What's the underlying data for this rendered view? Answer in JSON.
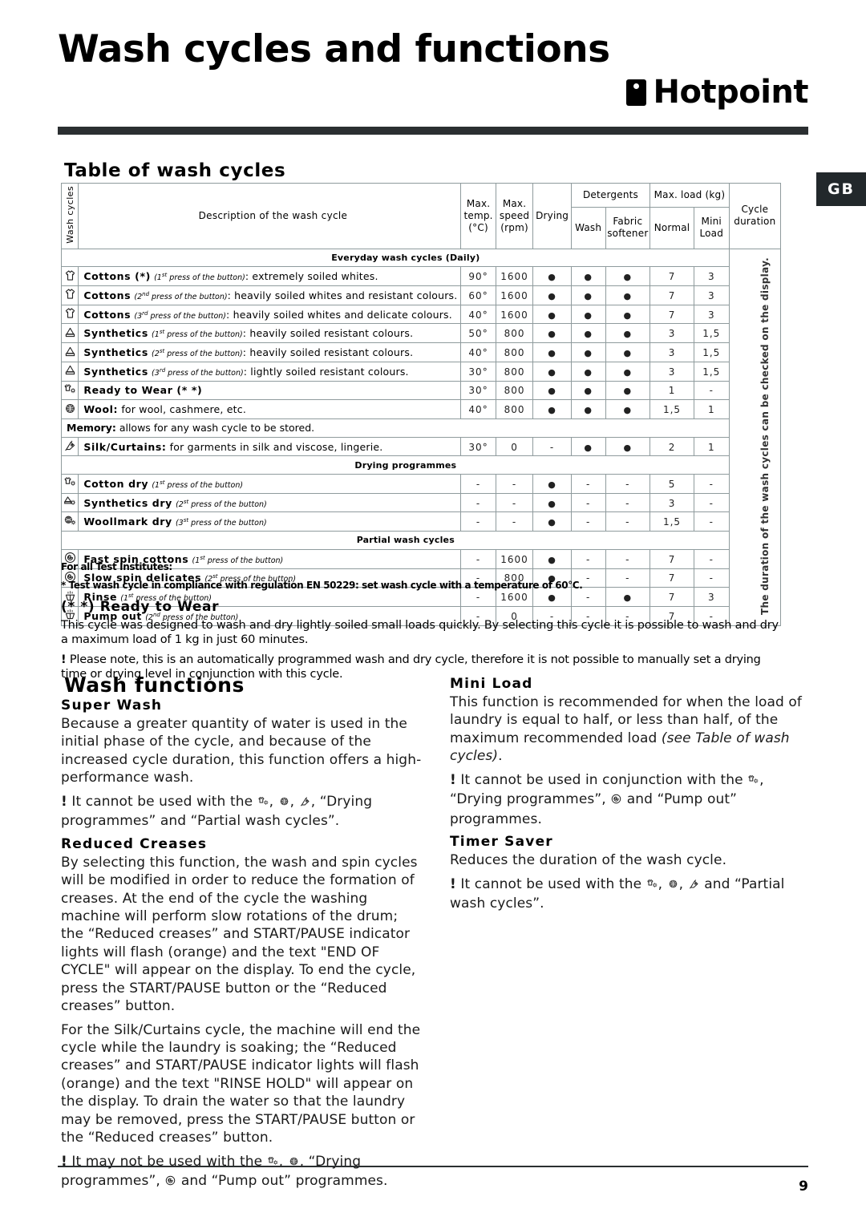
{
  "header": {
    "title": "Wash cycles and functions",
    "brand": "Hotpoint",
    "locale_tab": "GB"
  },
  "table_section": {
    "title": "Table of wash cycles",
    "vertical_label": "Wash cycles",
    "headers": {
      "description": "Description of the wash cycle",
      "max_temp": "Max. temp. (°C)",
      "max_temp_l1": "Max.",
      "max_temp_l2": "temp.",
      "max_temp_l3": "(°C)",
      "max_speed_l1": "Max.",
      "max_speed_l2": "speed",
      "max_speed_l3": "(rpm)",
      "drying": "Drying",
      "detergents": "Detergents",
      "wash": "Wash",
      "fabric_softener_l1": "Fabric",
      "fabric_softener_l2": "softener",
      "max_load": "Max. load (kg)",
      "normal": "Normal",
      "mini_l1": "Mini",
      "mini_l2": "Load",
      "cycle_duration_l1": "Cycle",
      "cycle_duration_l2": "duration"
    },
    "duration_note": "The duration of the wash cycles can be checked on the display.",
    "bands": {
      "everyday": "Everyday wash cycles (Daily)",
      "drying": "Drying programmes",
      "partial": "Partial wash cycles"
    },
    "rows": [
      {
        "icon": "tshirt-icon",
        "name": "Cottons (*)",
        "press": "(1st press of the button)",
        "press_ord": "st",
        "press_num": "1",
        "detail": ": extremely soiled whites.",
        "temp": "90°",
        "speed": "1600",
        "dry": "•",
        "wash": "•",
        "softener": "•",
        "normal": "7",
        "mini": "3"
      },
      {
        "icon": "tshirt-icon",
        "name": "Cottons",
        "press_num": "2",
        "press_ord": "nd",
        "press": "(2nd press of the button)",
        "detail": ": heavily soiled whites and resistant colours.",
        "temp": "60°",
        "speed": "1600",
        "dry": "•",
        "wash": "•",
        "softener": "•",
        "normal": "7",
        "mini": "3"
      },
      {
        "icon": "tshirt-icon",
        "name": "Cottons",
        "press_num": "3",
        "press_ord": "rd",
        "press": "(3rd press of the button)",
        "detail": ": heavily soiled whites and delicate colours.",
        "temp": "40°",
        "speed": "1600",
        "dry": "•",
        "wash": "•",
        "softener": "•",
        "normal": "7",
        "mini": "3"
      },
      {
        "icon": "synthetics-icon",
        "name": "Synthetics",
        "press_num": "1",
        "press_ord": "st",
        "press": "(1st press of the button)",
        "detail": ": heavily soiled resistant colours.",
        "temp": "50°",
        "speed": "800",
        "dry": "•",
        "wash": "•",
        "softener": "•",
        "normal": "3",
        "mini": "1,5"
      },
      {
        "icon": "synthetics-icon",
        "name": "Synthetics",
        "press_num": "2",
        "press_ord": "st",
        "press": "(2st press of the button)",
        "detail": ": heavily soiled resistant colours.",
        "temp": "40°",
        "speed": "800",
        "dry": "•",
        "wash": "•",
        "softener": "•",
        "normal": "3",
        "mini": "1,5"
      },
      {
        "icon": "synthetics-icon",
        "name": "Synthetics",
        "press_num": "3",
        "press_ord": "rd",
        "press": "(3rd press of the button)",
        "detail": ": lightly soiled resistant colours.",
        "temp": "30°",
        "speed": "800",
        "dry": "•",
        "wash": "•",
        "softener": "•",
        "normal": "3",
        "mini": "1,5"
      },
      {
        "icon": "ready-to-wear-icon",
        "name": "Ready to Wear (* *)",
        "press": "",
        "press_num": "",
        "press_ord": "",
        "detail": "",
        "temp": "30°",
        "speed": "800",
        "dry": "•",
        "wash": "•",
        "softener": "•",
        "normal": "1",
        "mini": "-"
      },
      {
        "icon": "wool-icon",
        "name": "Wool:",
        "press": "",
        "press_num": "",
        "press_ord": "",
        "detail": " for wool, cashmere, etc.",
        "temp": "40°",
        "speed": "800",
        "dry": "•",
        "wash": "•",
        "softener": "•",
        "normal": "1,5",
        "mini": "1"
      }
    ],
    "memory_row": {
      "name": "Memory:",
      "detail": " allows for any wash cycle to be stored."
    },
    "silk_row": {
      "icon": "silk-icon",
      "name": "Silk/Curtains:",
      "detail": " for garments in silk and viscose, lingerie.",
      "temp": "30°",
      "speed": "0",
      "dry": "-",
      "wash": "•",
      "softener": "•",
      "normal": "2",
      "mini": "1"
    },
    "drying_rows": [
      {
        "icon": "cotton-dry-icon",
        "name": "Cotton dry",
        "press_num": "1",
        "press_ord": "st",
        "press": "(1st press of the button)",
        "detail": "",
        "temp": "-",
        "speed": "-",
        "dry": "•",
        "wash": "-",
        "softener": "-",
        "normal": "5",
        "mini": "-"
      },
      {
        "icon": "synthetics-dry-icon",
        "name": "Synthetics dry",
        "press_num": "2",
        "press_ord": "st",
        "press": "(2st press of the button)",
        "detail": "",
        "temp": "-",
        "speed": "-",
        "dry": "•",
        "wash": "-",
        "softener": "-",
        "normal": "3",
        "mini": "-"
      },
      {
        "icon": "woollmark-dry-icon",
        "name": "Woollmark dry",
        "press_num": "3",
        "press_ord": "st",
        "press": "(3st press of the button)",
        "detail": "",
        "temp": "-",
        "speed": "-",
        "dry": "•",
        "wash": "-",
        "softener": "-",
        "normal": "1,5",
        "mini": "-"
      }
    ],
    "partial_rows": [
      {
        "icon": "spin-icon",
        "name": "Fast spin cottons",
        "press_num": "1",
        "press_ord": "st",
        "press": "(1st press of the button)",
        "detail": "",
        "temp": "-",
        "speed": "1600",
        "dry": "•",
        "wash": "-",
        "softener": "-",
        "normal": "7",
        "mini": "-"
      },
      {
        "icon": "spin-icon",
        "name": "Slow spin delicates",
        "press_num": "2",
        "press_ord": "st",
        "press": "(2st press of the button)",
        "detail": "",
        "temp": "-",
        "speed": "800",
        "dry": "•",
        "wash": "-",
        "softener": "-",
        "normal": "7",
        "mini": "-"
      },
      {
        "icon": "rinse-icon",
        "name": "Rinse",
        "press_num": "1",
        "press_ord": "st",
        "press": "(1st press of the button)",
        "detail": "",
        "temp": "-",
        "speed": "1600",
        "dry": "•",
        "wash": "-",
        "softener": "•",
        "normal": "7",
        "mini": "3"
      },
      {
        "icon": "rinse-icon",
        "name": "Pump out",
        "press_num": "2",
        "press_ord": "nd",
        "press": "(2nd press of the button)",
        "detail": "",
        "temp": "-",
        "speed": "0",
        "dry": "-",
        "wash": "-",
        "softener": "-",
        "normal": "7",
        "mini": "-"
      }
    ]
  },
  "notes": {
    "institutes_label": "For all Test Institutes:",
    "institutes_note": "* Test wash cycle in compliance with regulation EN 50229: set wash cycle with a temperature of 60°C.",
    "ready_to_wear_head": "(* *) Ready to Wear",
    "ready_to_wear_body": "This cycle was designed to wash and dry lightly soiled small loads quickly. By selecting this cycle it is possible to wash and dry a maximum load of 1 kg in just 60 minutes.",
    "ready_to_wear_warn": "Please note, this is an automatically programmed wash and dry cycle, therefore it is not possible to manually set a drying time or drying level in conjunction with this cycle."
  },
  "wash_functions": {
    "title": "Wash functions",
    "left": [
      {
        "head": "Super Wash",
        "body": "Because a greater quantity of water is used in the initial phase of the cycle, and because of the increased cycle duration, this function offers a high-performance wash.",
        "warn_pre": "It cannot be used with the ",
        "warn_icons": [
          "ready-to-wear-icon",
          "wool-icon",
          "silk-icon"
        ],
        "warn_post": ", “Drying programmes” and “Partial wash cycles”."
      },
      {
        "head": "Reduced Creases",
        "body": "By selecting this function, the wash and spin cycles will be modified in order to reduce the formation of creases. At the end of the cycle the washing machine will perform slow rotations of the drum; the “Reduced creases” and START/PAUSE indicator lights will flash (orange) and the text \"END OF CYCLE\" will appear on the display. To end the cycle, press the START/PAUSE button or the “Reduced creases” button.",
        "body2": "For the Silk/Curtains cycle, the machine will end the cycle while the laundry is soaking; the “Reduced creases” and START/PAUSE indicator lights will flash (orange) and the text \"RINSE HOLD\" will appear on the display. To drain the water so that the laundry may be removed, press the START/PAUSE button or the “Reduced creases” button.",
        "warn_pre": "It may not be used with the ",
        "warn_icons": [
          "ready-to-wear-icon",
          "wool-icon"
        ],
        "warn_mid": ", “Drying programmes”, ",
        "warn_icon2": "spin-icon",
        "warn_post": " and “Pump out” programmes."
      }
    ],
    "right": [
      {
        "head": "Mini Load",
        "body_a": "This function is recommended for when the load of laundry is equal to half, or less than half, of the maximum recommended load ",
        "body_i": "(see Table of wash cycles)",
        "body_b": ".",
        "warn_pre": "It cannot be used in conjunction with the ",
        "warn_icons": [
          "ready-to-wear-icon"
        ],
        "warn_mid": ", “Drying programmes”, ",
        "warn_icon2": "spin-icon",
        "warn_post": " and “Pump out” programmes."
      },
      {
        "head": "Timer Saver",
        "body": "Reduces the duration of the wash cycle.",
        "warn_pre": "It cannot be used with the ",
        "warn_icons": [
          "ready-to-wear-icon",
          "wool-icon",
          "silk-icon"
        ],
        "warn_post": " and “Partial wash cycles”."
      }
    ]
  },
  "footer": {
    "page_number": "9"
  },
  "colors": {
    "band": "#ccd8d8",
    "rule": "#2b2f31",
    "tab": "#22282b",
    "border": "#8f9b9d"
  }
}
